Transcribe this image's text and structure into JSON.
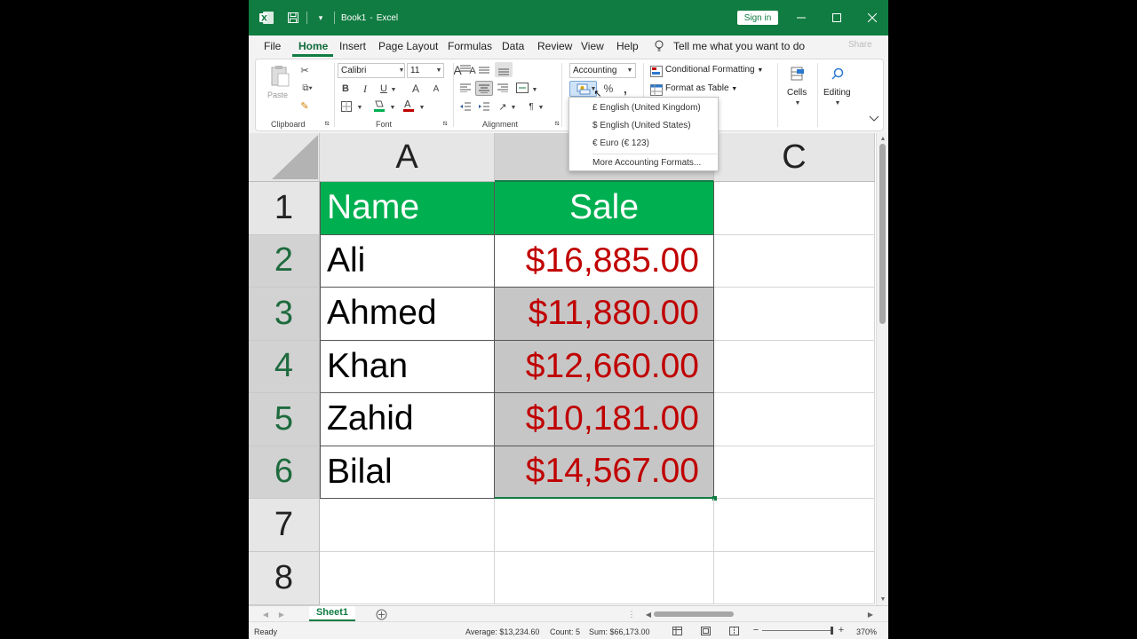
{
  "titlebar": {
    "book": "Book1",
    "separator": "-",
    "app": "Excel",
    "sign_in": "Sign in"
  },
  "menu": {
    "tabs": [
      "File",
      "Home",
      "Insert",
      "Page Layout",
      "Formulas",
      "Data",
      "Review",
      "View",
      "Help"
    ],
    "active": "Home",
    "tell_me": "Tell me what you want to do",
    "share": "Share"
  },
  "ribbon": {
    "clipboard": {
      "paste": "Paste",
      "label": "Clipboard"
    },
    "font": {
      "name": "Calibri",
      "size": "11",
      "bold": "B",
      "italic": "I",
      "underline": "U",
      "label": "Font"
    },
    "alignment": {
      "label": "Alignment"
    },
    "number": {
      "format": "Accounting",
      "percent": "%",
      "comma": ","
    },
    "styles": {
      "conditional": "Conditional Formatting",
      "format_table": "Format as Table"
    },
    "cells": {
      "label": "Cells"
    },
    "editing": {
      "label": "Editing"
    }
  },
  "currency_menu": {
    "items": [
      "£ English (United Kingdom)",
      "$ English (United States)",
      "€ Euro (€ 123)"
    ],
    "more": "More Accounting Formats..."
  },
  "sheet": {
    "columns": [
      "A",
      "C"
    ],
    "rows": [
      "1",
      "2",
      "3",
      "4",
      "5",
      "6",
      "7",
      "8"
    ],
    "header": {
      "name": "Name",
      "sale": "Sale"
    },
    "data": [
      {
        "name": "Ali",
        "sale": "$16,885.00"
      },
      {
        "name": "Ahmed",
        "sale": "$11,880.00"
      },
      {
        "name": "Khan",
        "sale": "$12,660.00"
      },
      {
        "name": "Zahid",
        "sale": "$10,181.00"
      },
      {
        "name": "Bilal",
        "sale": "$14,567.00"
      }
    ],
    "header_fill": "#00b050",
    "value_color": "#c00000"
  },
  "tabs": {
    "sheet": "Sheet1"
  },
  "status": {
    "ready": "Ready",
    "average": "Average: $13,234.60",
    "count": "Count: 5",
    "sum": "Sum: $66,173.00",
    "zoom": "370%"
  }
}
